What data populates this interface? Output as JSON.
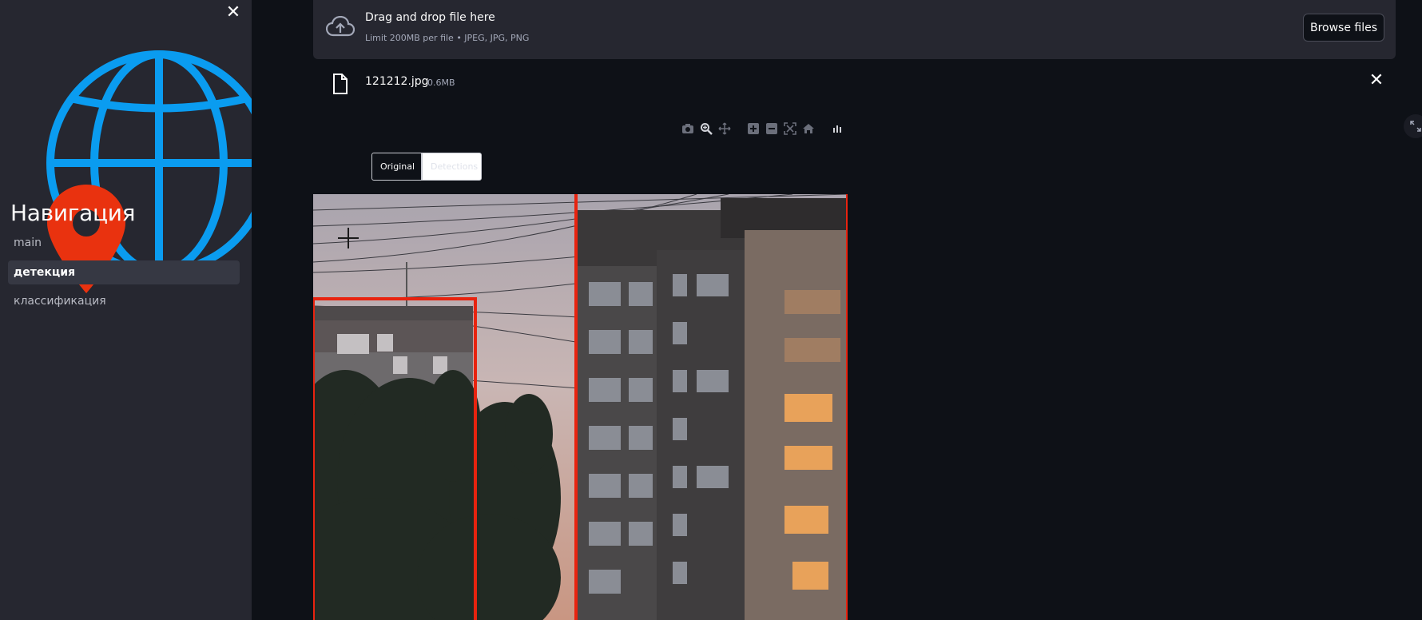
{
  "sidebar": {
    "close_symbol": "✕",
    "title": "Навигация",
    "items": [
      {
        "label": "main",
        "active": false
      },
      {
        "label": "детекция",
        "active": true
      },
      {
        "label": "классификация",
        "active": false
      }
    ],
    "globe_icon": "globe-icon",
    "pin_icon": "map-pin-icon",
    "colors": {
      "globe": "#0a9cf0",
      "pin": "#e9320f"
    }
  },
  "uploader": {
    "title": "Drag and drop file here",
    "subtitle": "Limit 200MB per file • JPEG, JPG, PNG",
    "browse_label": "Browse files",
    "icon": "cloud-upload-icon"
  },
  "file": {
    "name": "121212.jpg",
    "size": "0.6MB",
    "remove_symbol": "✕",
    "icon": "file-icon"
  },
  "modebar": {
    "buttons": [
      "camera-icon",
      "zoom-icon",
      "pan-icon",
      "zoom-in-icon",
      "zoom-out-icon",
      "autoscale-icon",
      "home-icon",
      "plotly-logo-icon"
    ]
  },
  "toggle": {
    "original_label": "Original",
    "detection_label": "Detections"
  },
  "image": {
    "alt": "apartment buildings at dusk with detection boxes",
    "box_color": "#e8230f"
  }
}
